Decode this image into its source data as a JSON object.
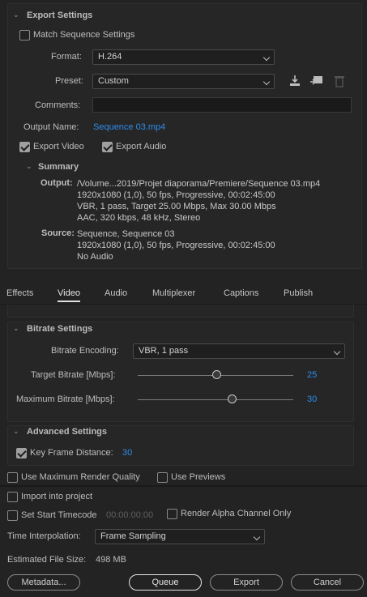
{
  "export_settings": {
    "title": "Export Settings",
    "match_sequence_label": "Match Sequence Settings",
    "match_sequence_checked": false,
    "format_label": "Format:",
    "format_value": "H.264",
    "preset_label": "Preset:",
    "preset_value": "Custom",
    "comments_label": "Comments:",
    "comments_value": "",
    "output_name_label": "Output Name:",
    "output_name_value": "Sequence 03.mp4",
    "export_video_label": "Export Video",
    "export_video_checked": true,
    "export_audio_label": "Export Audio",
    "export_audio_checked": true
  },
  "summary": {
    "title": "Summary",
    "output_label": "Output:",
    "output_lines": [
      "/Volume...2019/Projet diaporama/Premiere/Sequence 03.mp4",
      "1920x1080 (1,0), 50 fps, Progressive, 00:02:45:00",
      "VBR, 1 pass, Target 25.00 Mbps, Max 30.00 Mbps",
      "AAC, 320 kbps, 48 kHz, Stereo"
    ],
    "source_label": "Source:",
    "source_lines": [
      "Sequence, Sequence 03",
      "1920x1080 (1,0), 50 fps, Progressive, 00:02:45:00",
      "No Audio"
    ]
  },
  "tabs": [
    {
      "label": "Effects",
      "active": false
    },
    {
      "label": "Video",
      "active": true
    },
    {
      "label": "Audio",
      "active": false
    },
    {
      "label": "Multiplexer",
      "active": false
    },
    {
      "label": "Captions",
      "active": false
    },
    {
      "label": "Publish",
      "active": false
    }
  ],
  "bitrate": {
    "title": "Bitrate Settings",
    "encoding_label": "Bitrate Encoding:",
    "encoding_value": "VBR, 1 pass",
    "target_label": "Target Bitrate [Mbps]:",
    "target_value": "25",
    "max_label": "Maximum Bitrate [Mbps]:",
    "max_value": "30"
  },
  "advanced": {
    "title": "Advanced Settings",
    "key_frame_label": "Key Frame Distance:",
    "key_frame_value": "30",
    "key_frame_checked": true
  },
  "bottom": {
    "max_render_quality_label": "Use Maximum Render Quality",
    "use_previews_label": "Use Previews",
    "import_label": "Import into project",
    "start_timecode_label": "Set Start Timecode",
    "start_timecode_value": "00:00:00:00",
    "alpha_label": "Render Alpha Channel Only",
    "time_interp_label": "Time Interpolation:",
    "time_interp_value": "Frame Sampling",
    "file_size_label": "Estimated File Size:",
    "file_size_value": "498 MB"
  },
  "buttons": {
    "metadata": "Metadata...",
    "queue": "Queue",
    "export": "Export",
    "cancel": "Cancel"
  },
  "colors": {
    "background": "#232323",
    "accent_blue": "#2d8ceb",
    "text": "#b9b9b9"
  }
}
